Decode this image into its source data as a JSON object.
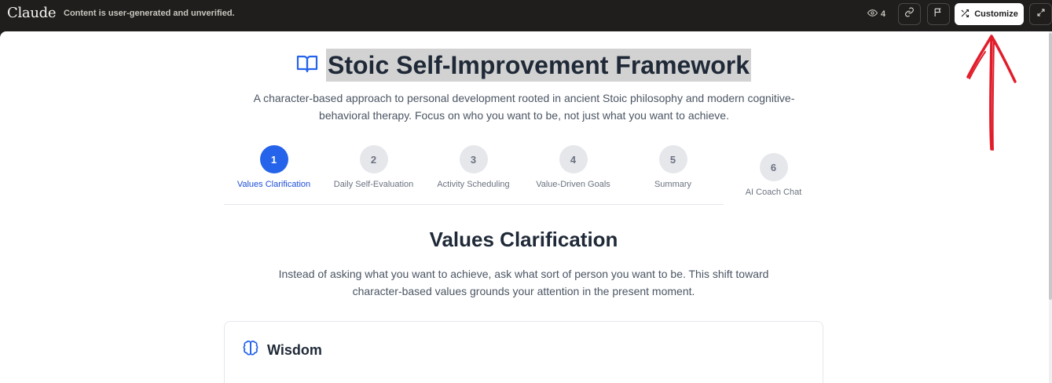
{
  "topbar": {
    "brand": "Claude",
    "notice": "Content is user-generated and unverified.",
    "views": "4",
    "customize_label": "Customize"
  },
  "header": {
    "title": "Stoic Self-Improvement Framework",
    "subtitle": "A character-based approach to personal development rooted in ancient Stoic philosophy and modern cognitive-behavioral therapy. Focus on who you want to be, not just what you want to achieve."
  },
  "steps": [
    {
      "number": "1",
      "label": "Values Clarification",
      "active": true
    },
    {
      "number": "2",
      "label": "Daily Self-Evaluation",
      "active": false
    },
    {
      "number": "3",
      "label": "Activity Scheduling",
      "active": false
    },
    {
      "number": "4",
      "label": "Value-Driven Goals",
      "active": false
    },
    {
      "number": "5",
      "label": "Summary",
      "active": false
    },
    {
      "number": "6",
      "label": "AI Coach Chat",
      "active": false
    }
  ],
  "section": {
    "title": "Values Clarification",
    "description": "Instead of asking what you want to achieve, ask what sort of person you want to be. This shift toward character-based values grounds your attention in the present moment."
  },
  "cards": [
    {
      "title": "Wisdom",
      "icon": "brain-icon"
    }
  ],
  "colors": {
    "accent": "#2563eb",
    "topbar_bg": "#1f1e1d",
    "annotation": "#e11d2a"
  }
}
